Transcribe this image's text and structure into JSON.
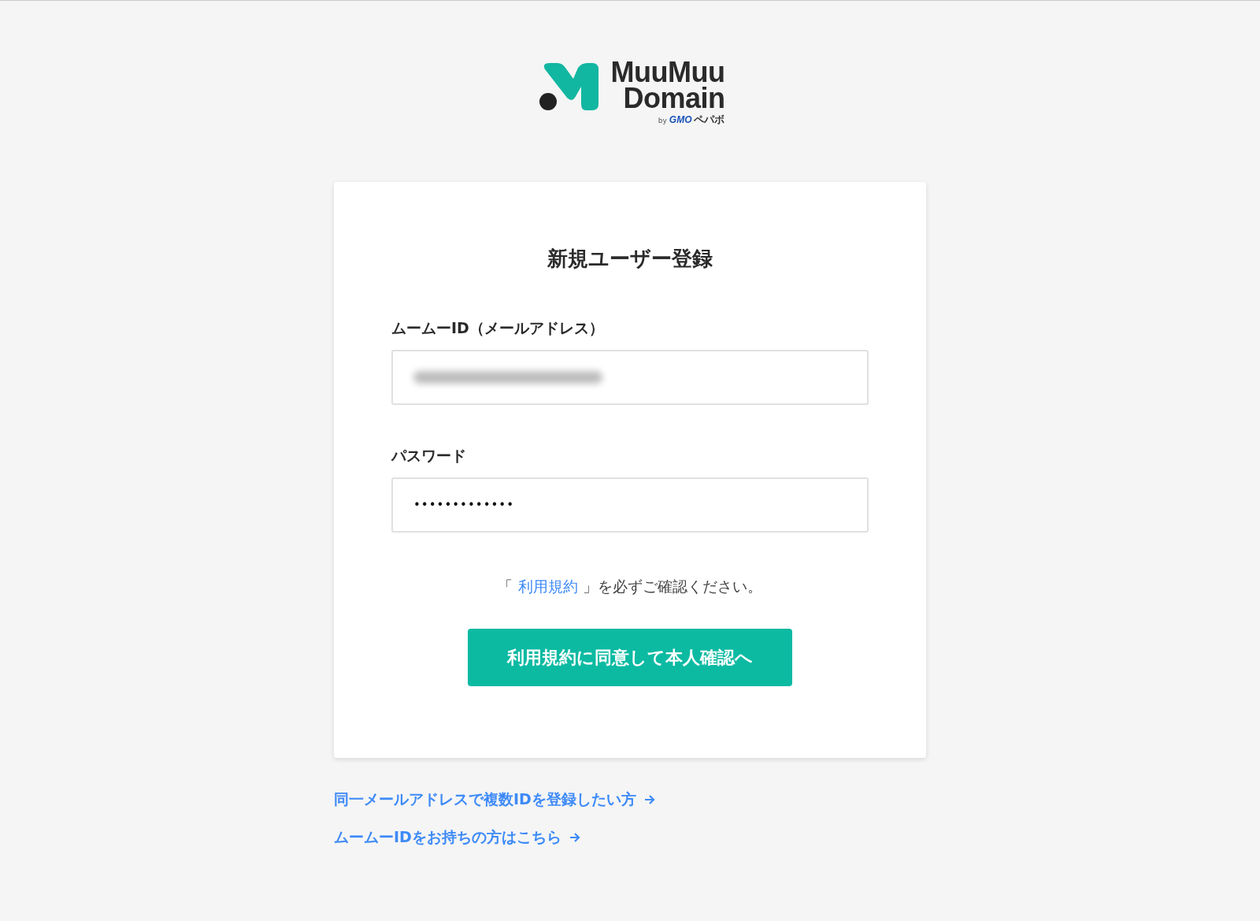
{
  "logo": {
    "line_1": "MuuMuu",
    "line_2": "Domain",
    "by": "by",
    "company": "GMO",
    "company_suffix": "ペパボ"
  },
  "form": {
    "title": "新規ユーザー登録",
    "fields": [
      {
        "label": "ムームーID（メールアドレス）",
        "kind": "redacted"
      },
      {
        "label": "パスワード",
        "kind": "text",
        "value": "•••••••••••••"
      }
    ],
    "terms": {
      "before": "「",
      "link": "利用規約",
      "after": "」を必ずご確認ください。"
    },
    "submit": "利用規約に同意して本人確認へ"
  },
  "links": [
    "同一メールアドレスで複数IDを登録したい方",
    "ムームーIDをお持ちの方はこちら"
  ]
}
